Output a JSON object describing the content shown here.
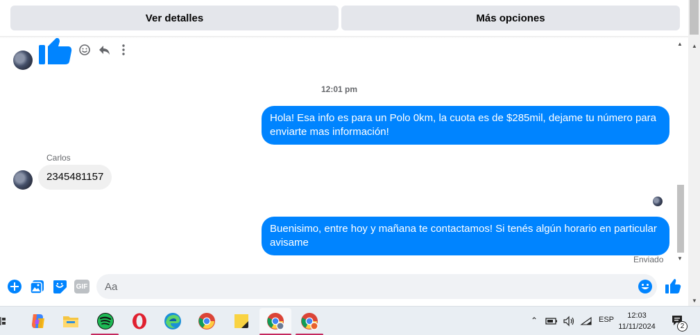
{
  "header": {
    "view_details": "Ver detalles",
    "more_options": "Más opciones"
  },
  "chat": {
    "timestamp": "12:01 pm",
    "messages": [
      {
        "direction": "out",
        "text": "Hola! Esa info es para un Polo 0km, la cuota es de $285mil, dejame tu número para enviarte mas información!"
      },
      {
        "direction": "in",
        "sender": "Carlos",
        "text": "2345481157"
      },
      {
        "direction": "out",
        "text": "Buenisimo, entre hoy y mañana te contactamos! Si tenés algún horario en particular avisame"
      }
    ],
    "status": "Enviado"
  },
  "composer": {
    "placeholder": "Aa",
    "gif_label": "GIF"
  },
  "taskbar": {
    "apps": [
      "copilot-icon",
      "file-explorer-icon",
      "spotify-icon",
      "opera-icon",
      "edge-icon",
      "chrome-icon",
      "sticky-notes-icon",
      "chrome-profile-icon",
      "chrome-profile-2-icon"
    ],
    "language": "ESP",
    "time": "12:03",
    "date": "11/11/2024",
    "notification_count": "2"
  },
  "colors": {
    "messenger_blue": "#0084ff",
    "bubble_gray": "#f0f0f0",
    "button_gray": "#e4e6eb"
  }
}
